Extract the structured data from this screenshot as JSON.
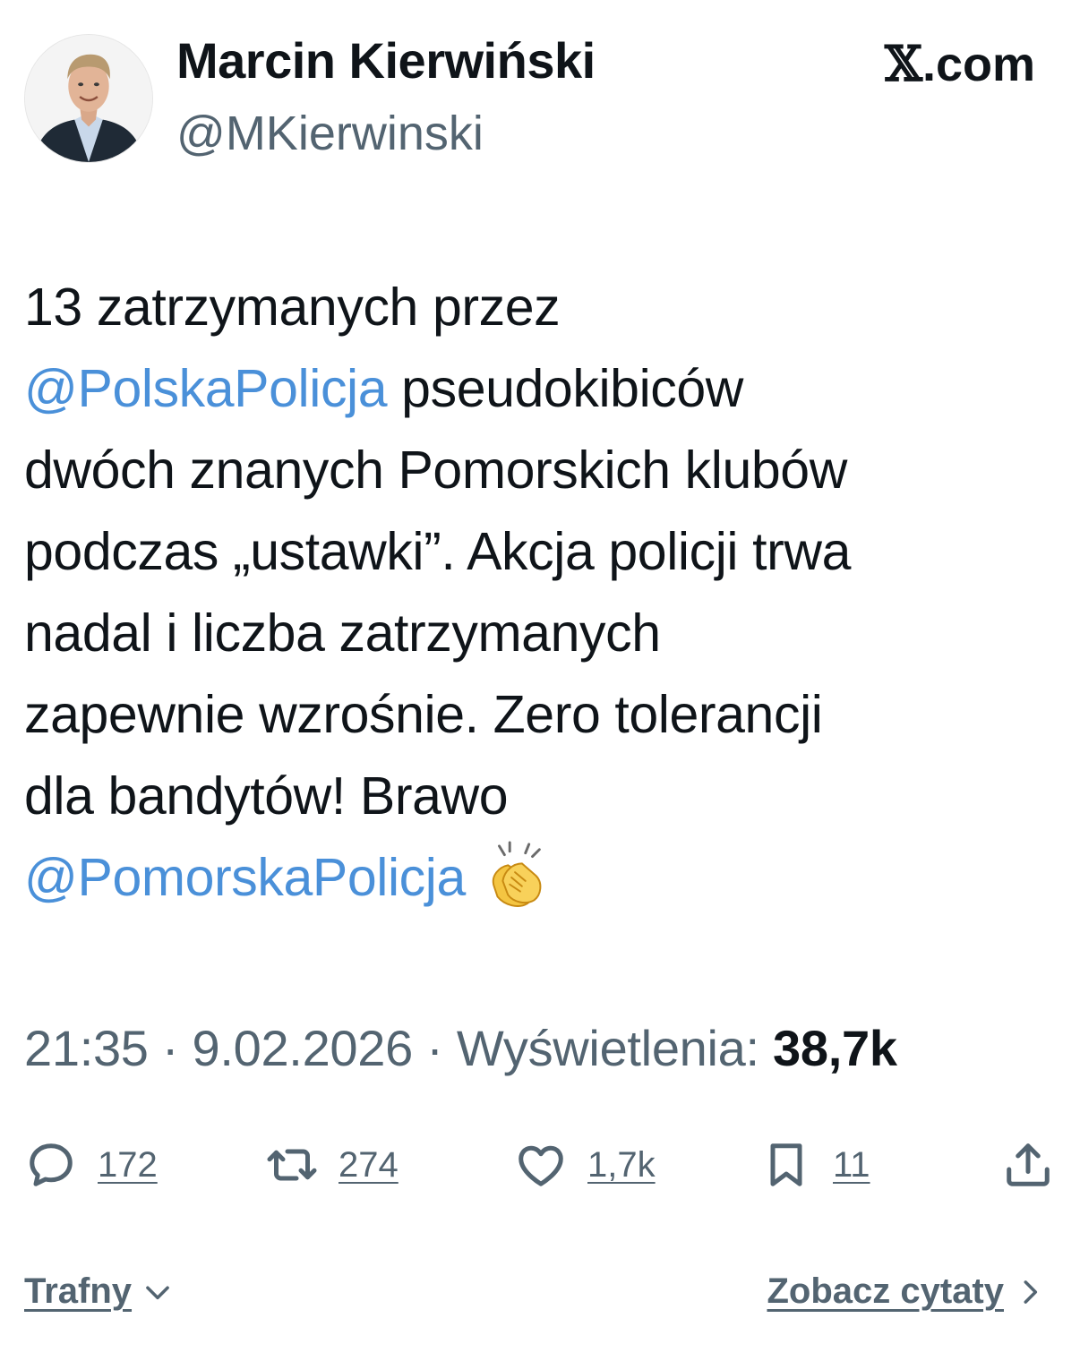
{
  "author": {
    "name": "Marcin Kierwiński",
    "handle": "@MKierwinski"
  },
  "site": {
    "x_glyph": "𝕏",
    "domain": ".com"
  },
  "tweet": {
    "lines": [
      [
        {
          "text": "13 zatrzymanych przez",
          "type": "text"
        }
      ],
      [
        {
          "text": "@PolskaPolicja",
          "type": "mention"
        },
        {
          "text": " pseudokibiców",
          "type": "text"
        }
      ],
      [
        {
          "text": "dwóch znanych Pomorskich klubów",
          "type": "text"
        }
      ],
      [
        {
          "text": "podczas „ustawki”. Akcja policji trwa",
          "type": "text"
        }
      ],
      [
        {
          "text": "nadal i liczba zatrzymanych",
          "type": "text"
        }
      ],
      [
        {
          "text": "zapewnie wzrośnie. Zero tolerancji",
          "type": "text"
        }
      ],
      [
        {
          "text": "dla bandytów! Brawo",
          "type": "text"
        }
      ],
      [
        {
          "text": "@PomorskaPolicja",
          "type": "mention"
        }
      ]
    ],
    "emoji": "clapping-hands"
  },
  "meta": {
    "time": "21:35",
    "separator": " · ",
    "date": "9.02.2026",
    "views_label": "Wyświetlenia:",
    "views_count": "38,7k"
  },
  "actions": {
    "replies": "172",
    "reposts": "274",
    "likes": "1,7k",
    "bookmarks": "11"
  },
  "footer": {
    "sort_label": "Trafny",
    "quotes_label": "Zobacz cytaty"
  },
  "colors": {
    "text": "#0f1419",
    "secondary": "#536471",
    "mention": "#4a90d9",
    "background": "#ffffff"
  }
}
